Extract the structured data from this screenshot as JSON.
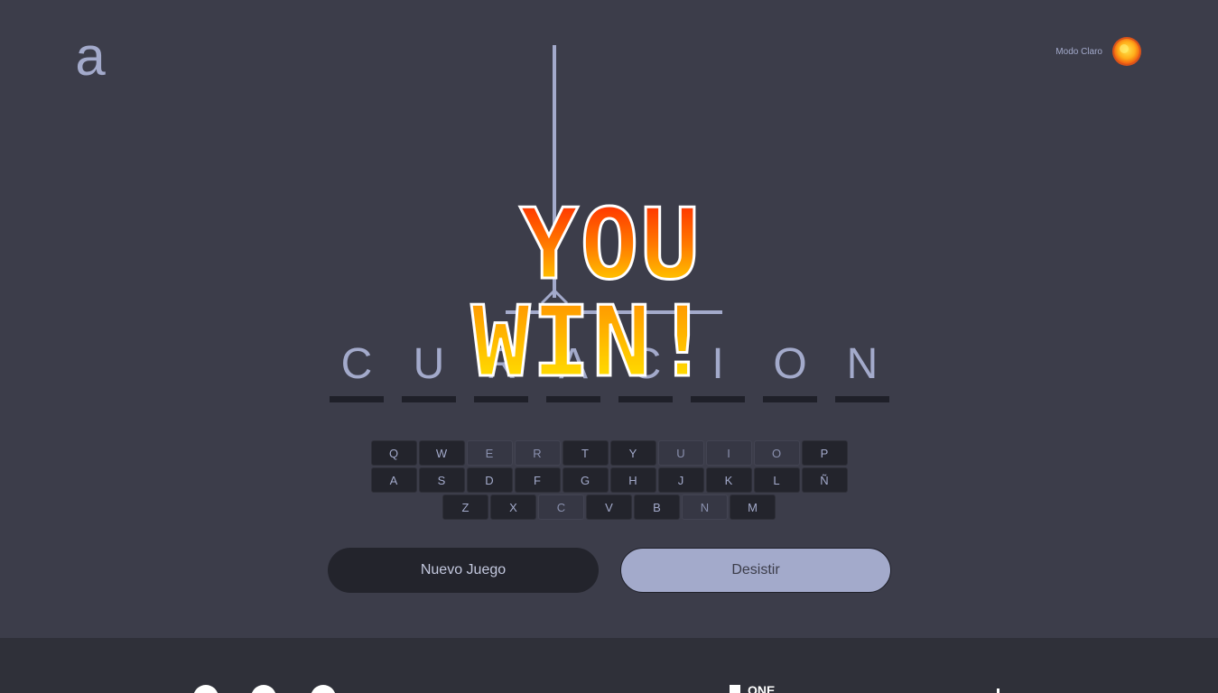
{
  "header": {
    "logo_letter": "a",
    "theme_label": "Modo Claro"
  },
  "game": {
    "word_letters": [
      "C",
      "U",
      "R",
      "A",
      "C",
      "I",
      "O",
      "N"
    ],
    "win_line1": "YOU",
    "win_line2": "WIN!"
  },
  "keyboard": {
    "rows": [
      [
        "Q",
        "W",
        "E",
        "R",
        "T",
        "Y",
        "U",
        "I",
        "O",
        "P"
      ],
      [
        "A",
        "S",
        "D",
        "F",
        "G",
        "H",
        "J",
        "K",
        "L",
        "Ñ"
      ],
      [
        "Z",
        "X",
        "C",
        "V",
        "B",
        "N",
        "M"
      ]
    ],
    "used": [
      "E",
      "R",
      "U",
      "I",
      "O",
      "C",
      "N"
    ]
  },
  "actions": {
    "new_game_label": "Nuevo Juego",
    "quit_label": "Desistir"
  },
  "footer": {
    "brand_text": "ONE"
  },
  "colors": {
    "background": "#3c3d4a",
    "footer": "#2f3039",
    "accent": "#a3aacb",
    "key_dark": "#23242c",
    "win_top": "#ff1a00",
    "win_bottom": "#ffee00"
  }
}
